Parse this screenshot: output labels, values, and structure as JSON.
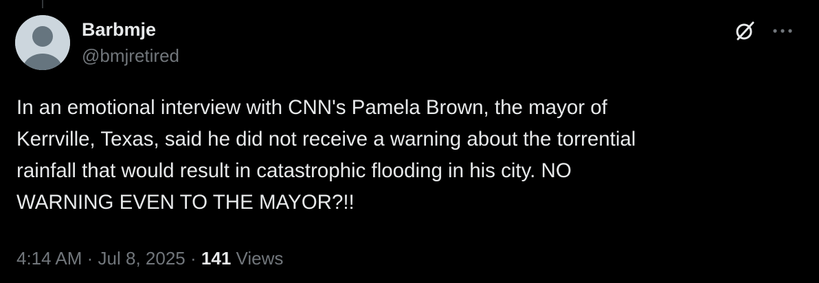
{
  "author": {
    "display_name": "Barbmje",
    "handle": "@bmjretired",
    "avatar_icon": "default-profile-avatar"
  },
  "actions": {
    "grok_icon": "grok-icon",
    "more_icon": "more-options-icon"
  },
  "tweet": {
    "lines": [
      "In an emotional interview with CNN's Pamela Brown, the mayor of",
      "Kerrville, Texas, said he did not receive a warning about the torrential",
      "rainfall that would result in catastrophic flooding in his city. NO",
      "WARNING EVEN TO THE MAYOR?!!"
    ]
  },
  "meta": {
    "time": "4:14 AM",
    "separator": "·",
    "date": "Jul 8, 2025",
    "views_count": "141",
    "views_label": "Views"
  },
  "colors": {
    "background": "#000000",
    "primary_text": "#e7e9ea",
    "secondary_text": "#71767b",
    "avatar_bg": "#ccd6dd",
    "avatar_fg": "#66757f"
  }
}
